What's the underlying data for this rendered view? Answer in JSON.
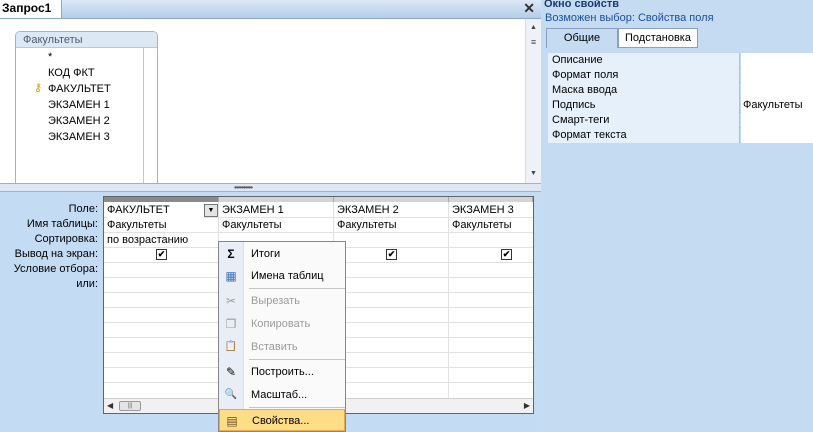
{
  "query_window": {
    "tab_title": "Запрос1",
    "close_glyph": "✕"
  },
  "table_box": {
    "title": "Факультеты",
    "fields": [
      "*",
      "КОД ФКТ",
      "ФАКУЛЬТЕТ",
      "ЭКЗАМЕН 1",
      "ЭКЗАМЕН 2",
      "ЭКЗАМЕН 3"
    ],
    "key_field": "КОД ФКТ"
  },
  "grid": {
    "row_labels": [
      "Поле:",
      "Имя таблицы:",
      "Сортировка:",
      "Вывод на экран:",
      "Условие отбора:",
      "или:"
    ],
    "columns": [
      {
        "field": "ФАКУЛЬТЕТ",
        "table": "Факультеты",
        "sort": "по возрастанию",
        "show": true
      },
      {
        "field": "ЭКЗАМЕН 1",
        "table": "Факультеты",
        "sort": "",
        "show": true
      },
      {
        "field": "ЭКЗАМЕН 2",
        "table": "Факультеты",
        "sort": "",
        "show": true
      },
      {
        "field": "ЭКЗАМЕН 3",
        "table": "Факультеты",
        "sort": "",
        "show": true
      }
    ],
    "check_glyph": "✔"
  },
  "context_menu": {
    "items": [
      {
        "label": "Итоги",
        "icon": "sigma-icon",
        "glyph": "Σ",
        "enabled": true
      },
      {
        "label": "Имена таблиц",
        "icon": "table-names-icon",
        "glyph": "▦",
        "enabled": true
      },
      {
        "label": "Вырезать",
        "icon": "scissors-icon",
        "glyph": "✂",
        "enabled": false
      },
      {
        "label": "Копировать",
        "icon": "copy-icon",
        "glyph": "❐",
        "enabled": false
      },
      {
        "label": "Вставить",
        "icon": "paste-icon",
        "glyph": "📋",
        "enabled": false
      },
      {
        "label": "Построить...",
        "icon": "build-wand-icon",
        "glyph": "✎",
        "enabled": true
      },
      {
        "label": "Масштаб...",
        "icon": "zoom-icon",
        "glyph": "🔍",
        "enabled": true
      },
      {
        "label": "Свойства...",
        "icon": "properties-icon",
        "glyph": "▤",
        "enabled": true,
        "highlighted": true
      }
    ]
  },
  "property_sheet": {
    "title": "Окно свойств",
    "selection_label": "Возможен выбор:",
    "selection_value": "Свойства поля",
    "tabs": [
      "Общие",
      "Подстановка"
    ],
    "active_tab": "Общие",
    "rows": [
      {
        "label": "Описание",
        "value": ""
      },
      {
        "label": "Формат поля",
        "value": ""
      },
      {
        "label": "Маска ввода",
        "value": ""
      },
      {
        "label": "Подпись",
        "value": "Факультеты"
      },
      {
        "label": "Смарт-теги",
        "value": ""
      },
      {
        "label": "Формат текста",
        "value": ""
      }
    ]
  },
  "colors": {
    "background": "#c5dcf3",
    "menu_highlight": "#fedd87",
    "title_text": "#1b3b70"
  }
}
